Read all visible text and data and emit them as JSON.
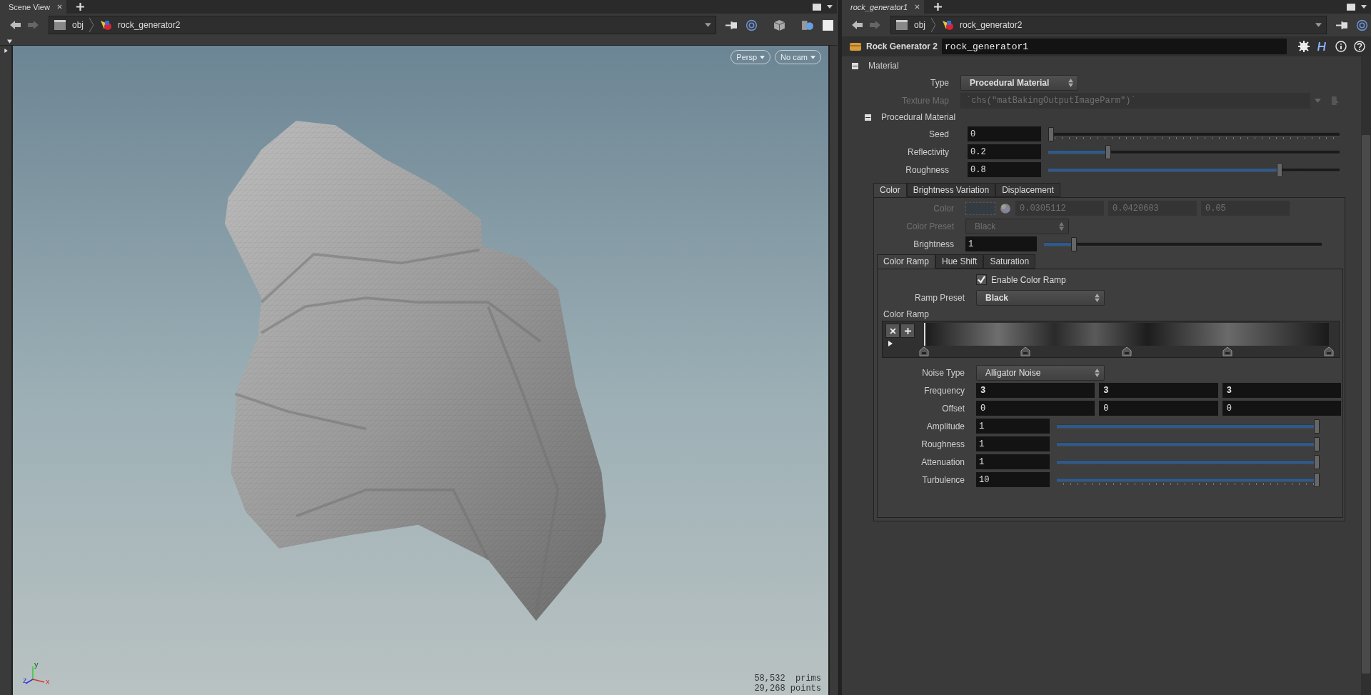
{
  "scene_view": {
    "tab": "Scene View",
    "path": [
      "obj",
      "rock_generator2"
    ],
    "camera_buttons": [
      "Persp",
      "No cam"
    ],
    "axis_labels": [
      "x",
      "y",
      "z"
    ],
    "stats": [
      "58,532  prims",
      "29,268 points"
    ]
  },
  "parameter_editor": {
    "tab": "rock_generator1",
    "path": [
      "obj",
      "rock_generator2"
    ],
    "node_type": "Rock Generator 2",
    "node_name": "rock_generator1",
    "material": {
      "label": "Material",
      "expanded": true,
      "type": {
        "label": "Type",
        "value": "Procedural Material"
      },
      "texture_map": {
        "label": "Texture Map",
        "value": "`chs(\"matBakingOutputImageParm\")`",
        "disabled": true
      },
      "procedural": {
        "label": "Procedural Material",
        "expanded": true,
        "sliders": [
          {
            "label": "Seed",
            "value": "0",
            "level": 0
          },
          {
            "label": "Reflectivity",
            "value": "0.2",
            "level": 0.2
          },
          {
            "label": "Roughness",
            "value": "0.8",
            "level": 0.8
          }
        ],
        "tabs": [
          {
            "label": "Color",
            "selected": true
          },
          {
            "label": "Brightness Variation",
            "selected": false
          },
          {
            "label": "Displacement",
            "selected": false
          }
        ],
        "color": {
          "label": "Color",
          "values": [
            "0.0305112",
            "0.0420603",
            "0.05"
          ],
          "disabled": true
        },
        "color_preset": {
          "label": "Color Preset",
          "value": "Black",
          "disabled": true
        },
        "brightness": {
          "label": "Brightness",
          "value": "1",
          "level": 0.1
        },
        "subtabs": [
          {
            "label": "Color Ramp",
            "selected": true
          },
          {
            "label": "Hue Shift",
            "selected": false
          },
          {
            "label": "Saturation",
            "selected": false
          }
        ],
        "enable_color_ramp": {
          "label": "Enable Color Ramp",
          "checked": true
        },
        "ramp_preset": {
          "label": "Ramp Preset",
          "value": "Black"
        },
        "color_ramp": {
          "label": "Color Ramp"
        },
        "noise_type": {
          "label": "Noise Type",
          "value": "Alligator Noise"
        },
        "vectors": [
          {
            "label": "Frequency",
            "values": [
              "3",
              "3",
              "3"
            ],
            "modified": true
          },
          {
            "label": "Offset",
            "values": [
              "0",
              "0",
              "0"
            ],
            "modified": false
          }
        ],
        "noise_sliders": [
          {
            "label": "Amplitude",
            "value": "1",
            "level": 1
          },
          {
            "label": "Roughness",
            "value": "1",
            "level": 1
          },
          {
            "label": "Attenuation",
            "value": "1",
            "level": 1
          },
          {
            "label": "Turbulence",
            "value": "10",
            "level": 1
          }
        ]
      }
    }
  }
}
